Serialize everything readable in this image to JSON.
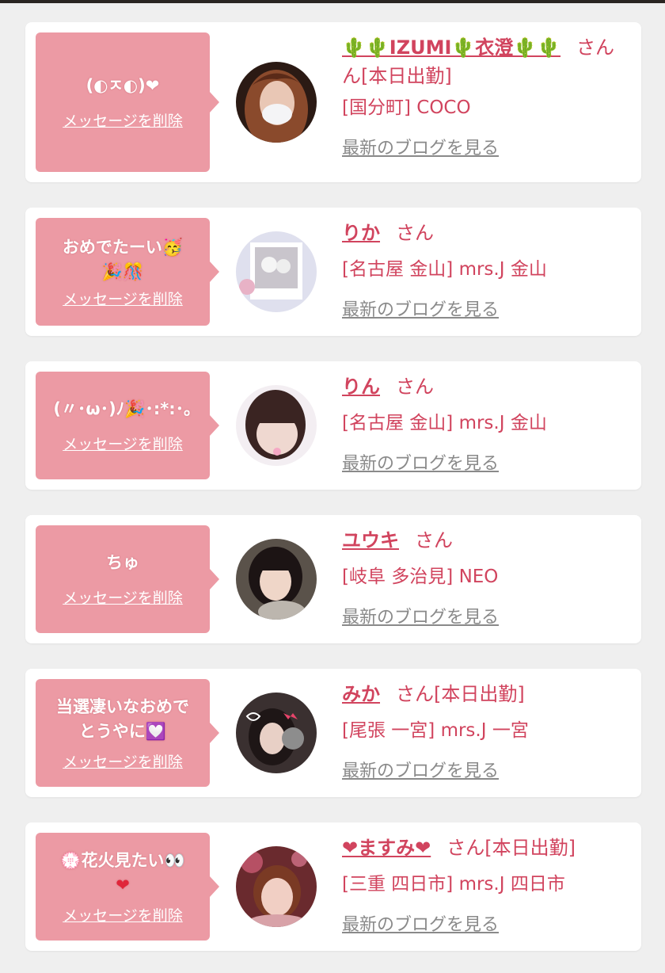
{
  "colors": {
    "bubble": "#ec9aa4",
    "name": "#d1445e",
    "link_gray": "#8a8a8a",
    "background": "#efefef"
  },
  "delete_label": "メッセージを削除",
  "blog_label": "最新のブログを見る",
  "san_label": "さん",
  "cards": [
    {
      "message_lines": [
        "(◐ㅈ◐)❤"
      ],
      "name": "🌵🌵IZUMI🌵衣澄🌵🌵",
      "name_suffix_line2": "ん[本日出勤]",
      "shop": "[国分町] COCO",
      "avatar": "woman-with-mask-photo"
    },
    {
      "message_lines": [
        "おめでたーい🥳",
        "🎉🎊"
      ],
      "name": "りか",
      "status": "",
      "shop": "[名古屋 金山] mrs.J 金山",
      "avatar": "polaroid-photo"
    },
    {
      "message_lines": [
        "(〃･ω･)ﾉ🎉･:*:･｡"
      ],
      "name": "りん",
      "status": "",
      "shop": "[名古屋 金山] mrs.J 金山",
      "avatar": "woman-bangs-photo"
    },
    {
      "message_lines": [
        "ちゅ"
      ],
      "name": "ユウキ",
      "status": "",
      "shop": "[岐阜 多治見] NEO",
      "avatar": "woman-dark-hair-photo"
    },
    {
      "message_lines": [
        "当選凄いなおめで",
        "とうやに💟"
      ],
      "name": "みか",
      "status": "[本日出勤]",
      "shop": "[尾張 一宮] mrs.J 一宮",
      "avatar": "woman-with-cat-sticker-photo"
    },
    {
      "message_lines": [
        "💮花火見たい👀",
        "❤"
      ],
      "name": "❤ますみ❤",
      "status": "[本日出勤]",
      "shop": "[三重 四日市] mrs.J 四日市",
      "avatar": "woman-pink-bokeh-photo"
    }
  ]
}
